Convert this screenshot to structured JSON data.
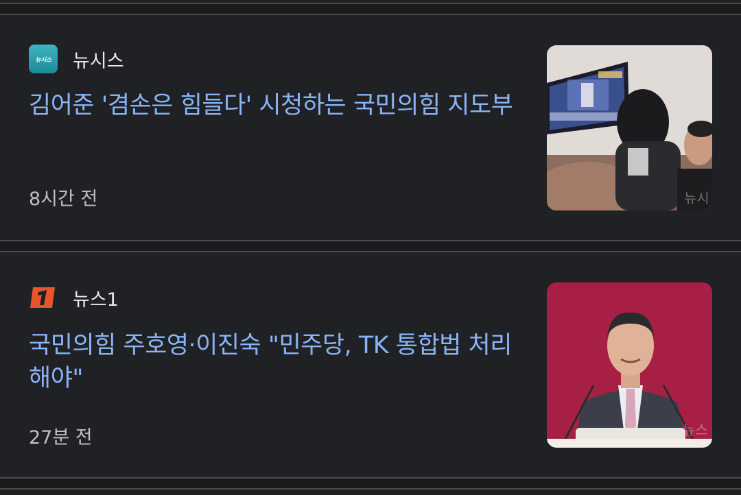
{
  "articles": [
    {
      "source": "뉴시스",
      "source_logo_icon": "newsis-logo",
      "headline": "김어준 '겸손은 힘들다' 시청하는 국민의힘 지도부",
      "time": "8시간 전",
      "thumbnail_icon": "meeting-photo"
    },
    {
      "source": "뉴스1",
      "source_logo_icon": "news1-logo",
      "headline": "국민의힘 주호영·이진숙 \"민주당, TK 통합법 처리해야\"",
      "time": "27분 전",
      "thumbnail_icon": "podium-speaker-photo"
    }
  ],
  "colors": {
    "background": "#202124",
    "headline": "#8ab4f8",
    "meta": "#bdc1c6",
    "divider": "#4a4b4e"
  }
}
